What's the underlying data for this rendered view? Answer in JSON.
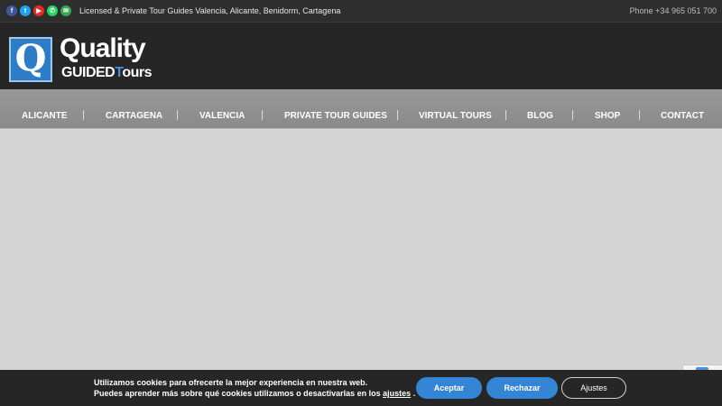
{
  "topbar": {
    "social_icons": [
      {
        "name": "facebook-icon",
        "glyph": "f",
        "color": "#3b5998"
      },
      {
        "name": "twitter-icon",
        "glyph": "t",
        "color": "#1da1f2"
      },
      {
        "name": "youtube-icon",
        "glyph": "▶",
        "color": "#e52d27"
      },
      {
        "name": "whatsapp-icon",
        "glyph": "✆",
        "color": "#25d366"
      },
      {
        "name": "email-icon",
        "glyph": "✉",
        "color": "#35a853"
      }
    ],
    "tagline": "Licensed & Private Tour Guides Valencia, Alicante, Benidorm, Cartagena",
    "phone": "Phone +34 965 051 700"
  },
  "logo": {
    "letter": "Q",
    "word1": "Quality",
    "guided": "GUIDED",
    "tours_t": "T",
    "tours_rest": "ours"
  },
  "nav": {
    "items": [
      "ALICANTE",
      "CARTAGENA",
      "VALENCIA",
      "PRIVATE TOUR GUIDES",
      "VIRTUAL TOURS",
      "BLOG",
      "SHOP",
      "CONTACT"
    ]
  },
  "cookie": {
    "line1": "Utilizamos cookies para ofrecerte la mejor experiencia en nuestra web.",
    "line2_pre": "Puedes aprender más sobre qué cookies utilizamos o desactivarlas en los",
    "line2_link": "ajustes",
    "line2_post": ".",
    "accept": "Aceptar",
    "reject": "Rechazar",
    "settings": "Ajustes"
  },
  "colors": {
    "accent": "#3485d6",
    "brand_blue": "#2d7cc8"
  }
}
